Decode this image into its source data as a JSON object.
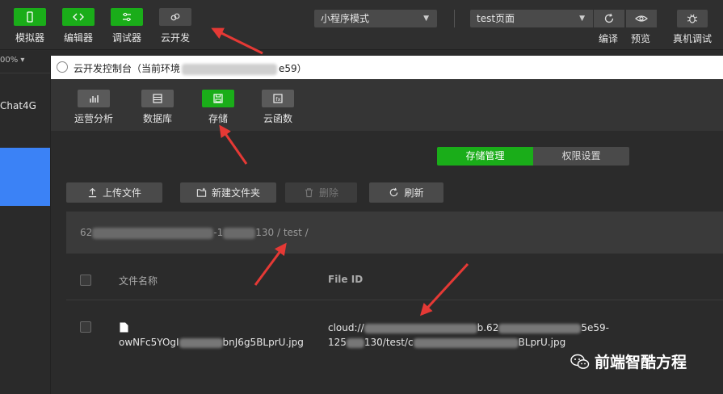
{
  "toolbar": {
    "buttons": [
      {
        "label": "模拟器",
        "icon": "phone-icon",
        "style": "green"
      },
      {
        "label": "编辑器",
        "icon": "code-icon",
        "style": "green"
      },
      {
        "label": "调试器",
        "icon": "sliders-icon",
        "style": "green"
      },
      {
        "label": "云开发",
        "icon": "cloud-link-icon",
        "style": "gray"
      }
    ],
    "mode_select": "小程序模式",
    "page_select": "test页面",
    "right_buttons": [
      {
        "label": "编译",
        "icon": "refresh-icon"
      },
      {
        "label": "预览",
        "icon": "eye-icon"
      },
      {
        "label": "真机调试",
        "icon": "bug-icon"
      }
    ]
  },
  "left_panel": {
    "zoom": "00% ▾",
    "item": "Chat4G"
  },
  "modal": {
    "title_prefix": "云开发控制台（当前环境",
    "title_suffix": "e59）",
    "tabs": [
      {
        "label": "运营分析",
        "icon": "bar-chart-icon",
        "active": false
      },
      {
        "label": "数据库",
        "icon": "database-icon",
        "active": false
      },
      {
        "label": "存储",
        "icon": "storage-icon",
        "active": true
      },
      {
        "label": "云函数",
        "icon": "function-icon",
        "active": false
      }
    ],
    "segments": {
      "active": "存储管理",
      "inactive": "权限设置"
    },
    "actions": [
      {
        "label": "上传文件",
        "icon": "upload-icon",
        "enabled": true
      },
      {
        "label": "新建文件夹",
        "icon": "new-folder-icon",
        "enabled": true
      },
      {
        "label": "删除",
        "icon": "trash-icon",
        "enabled": false
      },
      {
        "label": "刷新",
        "icon": "refresh-icon",
        "enabled": true
      }
    ],
    "breadcrumb": {
      "part1": "62",
      "part2": "-1",
      "part3": "130 / test /"
    },
    "table": {
      "headers": {
        "name": "文件名称",
        "file_id": "File ID"
      },
      "row": {
        "name_start": "owNFc5YOgI",
        "name_end": "bnJ6g5BLprU.jpg",
        "id_line1_start": "cloud://",
        "id_line1_mid": "b.62",
        "id_line1_end": "5e59-",
        "id_line2_start": "125",
        "id_line2_mid": "130/test/c",
        "id_line2_end": "BLprU.jpg"
      }
    }
  },
  "watermark": {
    "text": "前端智酷方程"
  },
  "colors": {
    "green": "#1aad19",
    "arrow_red": "#e53935",
    "selected_blue": "#3b82f6"
  }
}
